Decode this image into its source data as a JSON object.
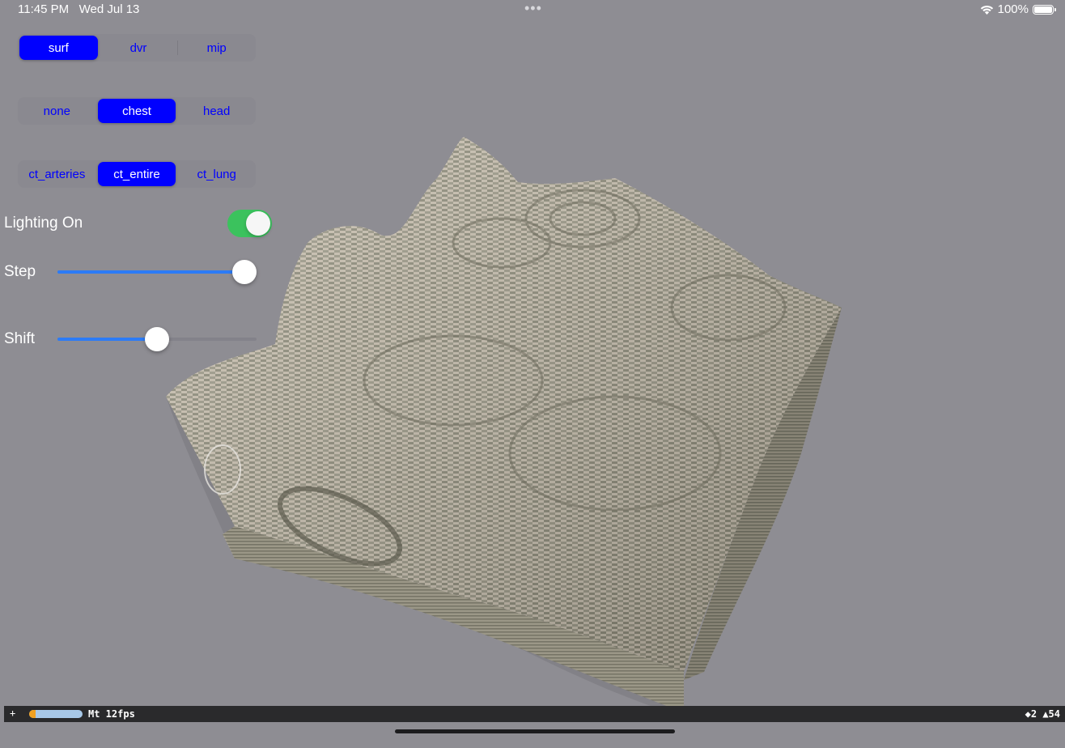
{
  "status_bar": {
    "time": "11:45 PM",
    "date": "Wed Jul 13",
    "dots": "•••",
    "battery": "100%"
  },
  "render_modes": {
    "items": [
      "surf",
      "dvr",
      "mip"
    ],
    "selected": "surf"
  },
  "presets": {
    "items": [
      "none",
      "chest",
      "head"
    ],
    "selected": "chest"
  },
  "transfer_functions": {
    "items": [
      "ct_arteries",
      "ct_entire",
      "ct_lung"
    ],
    "selected": "ct_entire"
  },
  "lighting": {
    "label": "Lighting On",
    "on": true,
    "color": "#34c759"
  },
  "step": {
    "label": "Step",
    "value_fraction": 0.94
  },
  "shift": {
    "label": "Shift",
    "value_fraction": 0.5
  },
  "perf": {
    "plus": "+",
    "fps_text": "Mt 12fps",
    "load_fraction": 0.12,
    "right_text": "◆2 ▲54"
  },
  "colors": {
    "background": "#8e8d93",
    "accent": "#0000ff",
    "slider": "#2c7bf6"
  }
}
